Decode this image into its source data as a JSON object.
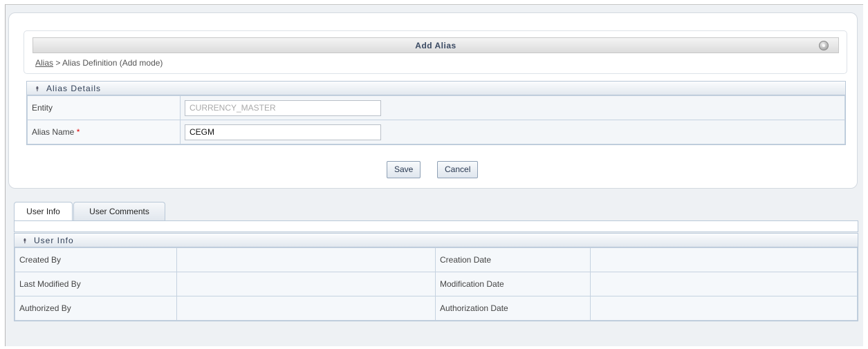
{
  "header": {
    "title": "Add Alias",
    "breadcrumb_link": "Alias",
    "breadcrumb_rest": " > Alias Definition (Add mode)"
  },
  "alias_details": {
    "section_title": "Alias Details",
    "entity_label": "Entity",
    "entity_value": "CURRENCY_MASTER",
    "alias_name_label": "Alias Name",
    "required_marker": "*",
    "alias_name_value": "CEGM"
  },
  "actions": {
    "save_label": "Save",
    "cancel_label": "Cancel"
  },
  "tabs": [
    {
      "label": "User Info",
      "active": true
    },
    {
      "label": "User Comments",
      "active": false
    }
  ],
  "user_info": {
    "section_title": "User Info",
    "rows": [
      {
        "left_label": "Created By",
        "left_value": "",
        "right_label": "Creation Date",
        "right_value": ""
      },
      {
        "left_label": "Last Modified By",
        "left_value": "",
        "right_label": "Modification Date",
        "right_value": ""
      },
      {
        "left_label": "Authorized By",
        "left_value": "",
        "right_label": "Authorization Date",
        "right_value": ""
      }
    ]
  },
  "colors": {
    "border_blue": "#b9c8d8",
    "required_red": "#dd0000",
    "title_text": "#3a4a63"
  },
  "icons": {
    "help": "help-icon",
    "collapse": "collapse-double-chevron-up-icon"
  }
}
